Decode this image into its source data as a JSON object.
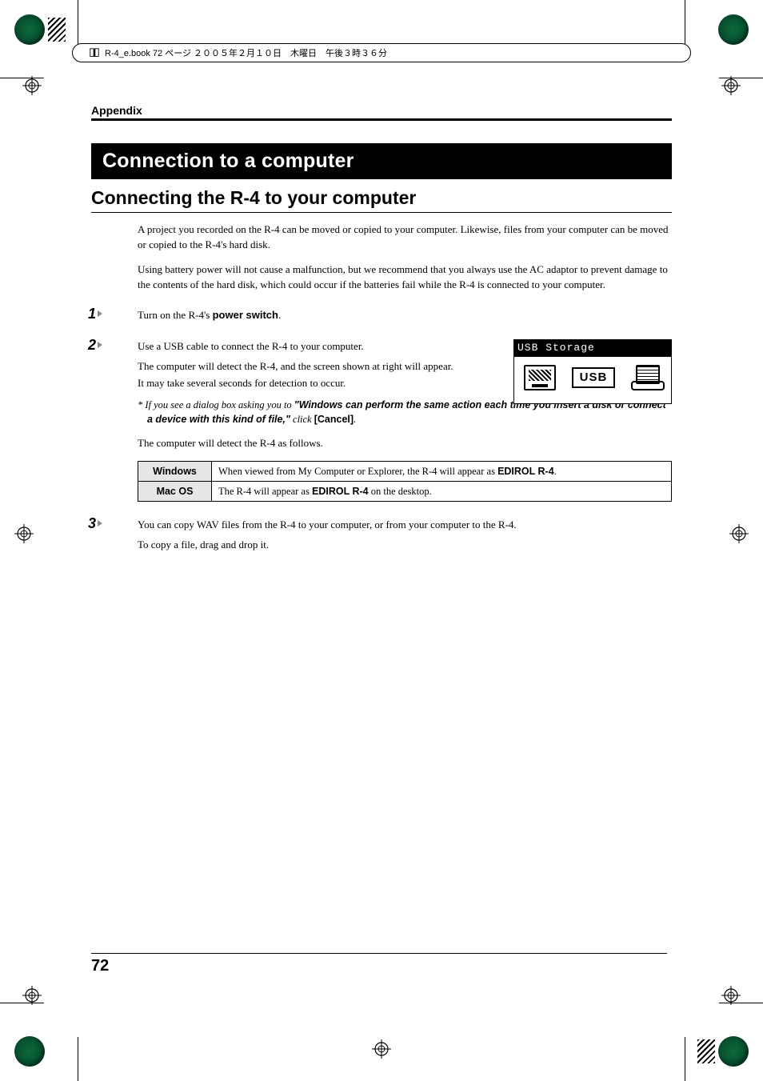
{
  "meta": {
    "header_line": "R-4_e.book  72 ページ  ２００５年２月１０日　木曜日　午後３時３６分"
  },
  "running_header": "Appendix",
  "title": "Connection to a computer",
  "subtitle": "Connecting the R-4 to your computer",
  "intro": {
    "p1": "A project you recorded on the R-4 can be moved or copied to your computer. Likewise, files from your computer can be moved or copied to the R-4's hard disk.",
    "p2": "Using battery power will not cause a malfunction, but we recommend that you always use the AC adaptor to prevent damage to the contents of the hard disk, which could occur if the batteries fail while the R-4 is connected to your computer."
  },
  "steps": {
    "s1": {
      "num": "1",
      "text_a": "Turn on the R-4's ",
      "text_b": "power switch",
      "text_c": "."
    },
    "s2": {
      "num": "2",
      "l1": "Use a USB cable to connect the R-4 to your computer.",
      "l2": "The computer will detect the R-4, and the screen shown at right will appear.",
      "l3": "It may take several seconds for detection to occur.",
      "note_prefix": "*  If you see a dialog box asking you to ",
      "note_bold": "\"Windows can perform the same action each time you insert a disk or connect a device with this kind of file,\"",
      "note_mid": " click ",
      "note_cancel": "[Cancel]",
      "note_end": ".",
      "detect_intro": "The computer will detect the R-4 as follows."
    },
    "s3": {
      "num": "3",
      "l1": "You can copy WAV files from the R-4 to your computer, or from your computer to the R-4.",
      "l2": "To copy a file, drag and drop it."
    }
  },
  "usb_box": {
    "title": "USB Storage",
    "label": "USB"
  },
  "table": {
    "rows": [
      {
        "os": "Windows",
        "text_a": "When viewed from My Computer or Explorer, the R-4 will appear as ",
        "text_bold": "EDIROL R-4",
        "text_c": "."
      },
      {
        "os": "Mac OS",
        "text_a": "The R-4 will appear as ",
        "text_bold": "EDIROL R-4",
        "text_c": " on the desktop."
      }
    ]
  },
  "page_number": "72"
}
